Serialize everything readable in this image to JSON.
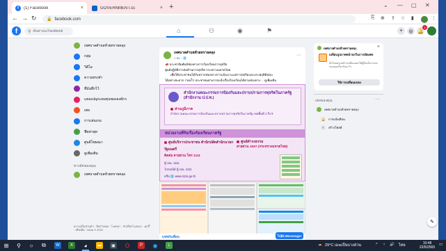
{
  "browser": {
    "tabs": [
      {
        "label": "(1) Facebook",
        "active": true
      },
      {
        "label": "GOVERNMENT.ss",
        "active": false
      }
    ],
    "address": "facebook.com"
  },
  "facebook": {
    "search_placeholder": "ค้นหาบน Facebook",
    "notification_count": "1",
    "sidebar": {
      "items": [
        {
          "label": "เทศบาลตำบลห้วยทรายคลุง",
          "color": "#7cb342",
          "icon": "page-avatar"
        },
        {
          "label": "กลุ่ม",
          "color": "#1877f2",
          "icon": "groups-icon"
        },
        {
          "label": "วิดีโอ",
          "color": "#1877f2",
          "icon": "video-icon"
        },
        {
          "label": "ความทรงจำ",
          "color": "#1877f2",
          "icon": "memories-icon"
        },
        {
          "label": "ที่บันทึกไว้",
          "color": "#8e24aa",
          "icon": "saved-icon"
        },
        {
          "label": "แคมเปญระดมทุนขององค์กร",
          "color": "#e91e63",
          "icon": "fundraiser-icon"
        },
        {
          "label": "เพจ",
          "color": "#f4511e",
          "icon": "pages-icon"
        },
        {
          "label": "การเล่นเกม",
          "color": "#1877f2",
          "icon": "gaming-icon"
        },
        {
          "label": "ฟีดล่าสุด",
          "color": "#43a047",
          "icon": "feed-icon"
        },
        {
          "label": "ศูนย์โฆษณา",
          "color": "#1e88e5",
          "icon": "ads-icon"
        },
        {
          "label": "ดูเพิ่มเติม",
          "color": "#65676b",
          "icon": "more-icon"
        }
      ],
      "shortcuts_heading": "ทางลัดของคุณ",
      "shortcuts": [
        {
          "label": "เทศบาลตำบลห้วยทรายคลุง"
        }
      ],
      "footer": "ความเป็นส่วนตัว · ข้อกำหนด · โฆษณา · ตัวเลือกโฆษณา · คุกกี้ · เพิ่มเติม · Meta © 2022"
    },
    "post": {
      "author": "เทศบาลตำบลห้วยทรายคลุง",
      "meta": "1 ชม. · 🌐",
      "lines": [
        "📣 ประชาสัมพันธ์ช่องทางการร้องเรียนการทุจริต",
        "ศูนย์ปฏิบัติการต่อต้านการทุจริต กระทรวงมหาดไทย",
        "เพื่อให้ประชาชนได้รับทราบช่องทางการแจ้งเบาะแสการทุจริตและประพฤติมิชอบ",
        "ได้อย่างสะดวก รวดเร็ว ประชาชนสามารถแจ้งเรื่องร้องเรียนได้ตามช่องทาง ... ดูเพิ่มเติม"
      ],
      "promo": {
        "title": "สำนักงานคณะกรรมการป้องกันและปราบปรามการทุจริตในภาครัฐ (สำนักงาน ป.ป.ท.)",
        "subtitle": "ส่วนภูมิภาค",
        "desc": "สำนักงานคณะกรรมการป้องกันและปราบปรามการทุจริตในภาครัฐ เขตพื้นที่ 1 ถึง 9",
        "band": "หน่วยงานที่รับเรื่องร้องเรียนภาครัฐ",
        "left": {
          "heading": "ศูนย์บริการประชาชน สำนักปลัดสำนักนายกรัฐมนตรี",
          "hotline": "ติดต่อ สายด่วน โทร 1111",
          "lines": [
            "ตู้ ปณ. 1111",
            "ไปรษณีย์ ตู้ ปณ. 1111",
            "หรือ 🌐 www.1111.go.th"
          ]
        },
        "right": {
          "heading": "ศูนย์ดำรงธรรม",
          "hotline": "สายด่วน 1567 (กระทรวงมหาดไทย)",
          "lines": []
        }
      }
    },
    "right": {
      "sponsor_name": "เทศบาลตำบลห้วยทรายคลุง",
      "card_title": "เปลี่ยนรูปภาพหน้าปกในการเปิดเพจ",
      "card_desc": "อัปโหลดรูปหน้าปกเพื่อแสดงให้ผู้อื่นเห็นว่าเพจของคุณเกี่ยวกับอะไร",
      "card_button": "ใช้การเปลี่ยนแปลง",
      "pages_heading": "เพจของคุณ",
      "page_name": "เทศบาลตำบลห้วยทรายคลุง",
      "page_items": [
        "การแจ้งเตือน",
        "สร้างโพสต์"
      ]
    },
    "chat_label": "แชทกับเพื่อน",
    "messenger_button": "ไปยัง Messenger"
  },
  "taskbar": {
    "weather": "29°C เมฆเป็นบางส่วน",
    "lang": "ไทย",
    "time": "10:48",
    "date": "22/6/2565"
  }
}
